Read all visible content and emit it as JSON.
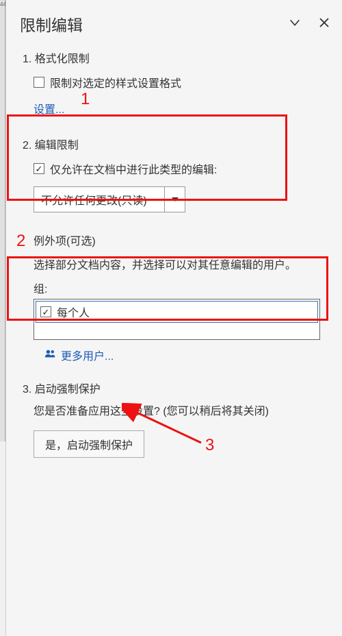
{
  "leftEdge": {
    "label": "44"
  },
  "panel": {
    "title": "限制编辑"
  },
  "section1": {
    "title": "1. 格式化限制",
    "checkbox_label": "限制对选定的样式设置格式",
    "settings_link": "设置..."
  },
  "section2": {
    "title": "2. 编辑限制",
    "checkbox_label": "仅允许在文档中进行此类型的编辑:",
    "dropdown_value": "不允许任何更改(只读)"
  },
  "exceptions": {
    "title": "例外项(可选)",
    "desc": "选择部分文档内容，并选择可以对其任意编辑的用户。",
    "group_label": "组:",
    "everyone": "每个人",
    "more_users": "更多用户..."
  },
  "section3": {
    "title": "3. 启动强制保护",
    "desc": "您是否准备应用这些设置? (您可以稍后将其关闭)",
    "button": "是，启动强制保护"
  },
  "annotations": {
    "n1": "1",
    "n2": "2",
    "n3": "3"
  }
}
